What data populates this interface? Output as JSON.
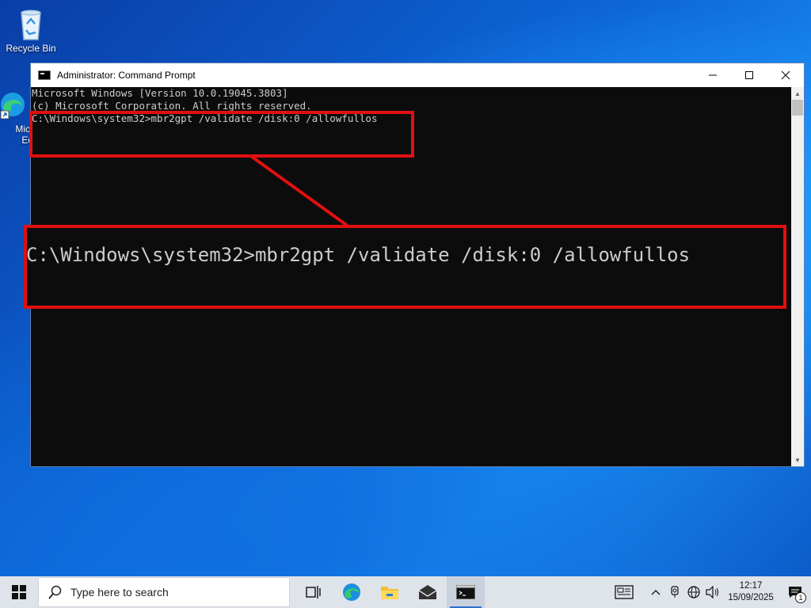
{
  "desktop": {
    "icons": [
      {
        "label": "Recycle Bin",
        "icon": "recycle-bin-icon"
      },
      {
        "label": "Micr\nEd",
        "icon": "edge-shortcut-icon"
      }
    ]
  },
  "window": {
    "title": "Administrator: Command Prompt",
    "buttons": {
      "minimize": "—",
      "maximize": "☐",
      "close": "✕"
    },
    "console_lines": [
      "Microsoft Windows [Version 10.0.19045.3803]",
      "(c) Microsoft Corporation. All rights reserved.",
      "",
      "C:\\Windows\\system32>mbr2gpt /validate /disk:0 /allowfullos"
    ]
  },
  "callout": {
    "zoom_text": "C:\\Windows\\system32>mbr2gpt /validate /disk:0 /allowfullos",
    "color": "#e01010"
  },
  "taskbar": {
    "search_placeholder": "Type here to search",
    "apps": [
      "task-view-icon",
      "edge-icon",
      "file-explorer-icon",
      "mail-icon",
      "command-prompt-icon"
    ],
    "clock_time": "12:17",
    "clock_date": "15/09/2025",
    "notification_count": "1"
  }
}
